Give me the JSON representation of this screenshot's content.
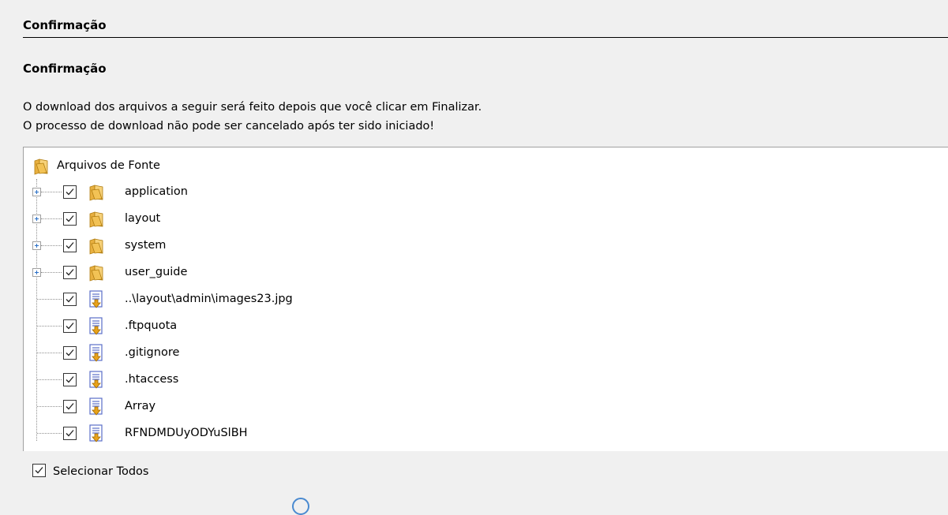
{
  "section_header": "Confirmação",
  "heading": "Confirmação",
  "description": {
    "line1": "O download dos arquivos a seguir será feito depois que você clicar em Finalizar.",
    "line2": "O processo de download não pode ser cancelado após ter sido iniciado!"
  },
  "tree": {
    "root_label": "Arquivos de Fonte",
    "folders": [
      {
        "label": "application",
        "checked": true,
        "icon": "folder-icon"
      },
      {
        "label": "layout",
        "checked": true,
        "icon": "folder-icon"
      },
      {
        "label": "system",
        "checked": true,
        "icon": "folder-icon"
      },
      {
        "label": "user_guide",
        "checked": true,
        "icon": "folder-icon"
      }
    ],
    "files": [
      {
        "label": "..\\layout\\admin\\images23.jpg",
        "checked": true,
        "icon": "file-download-icon"
      },
      {
        "label": ".ftpquota",
        "checked": true,
        "icon": "file-download-icon"
      },
      {
        "label": ".gitignore",
        "checked": true,
        "icon": "file-download-icon"
      },
      {
        "label": ".htaccess",
        "checked": true,
        "icon": "file-download-icon"
      },
      {
        "label": "Array",
        "checked": true,
        "icon": "file-download-icon"
      },
      {
        "label": "RFNDMDUyODYuSlBH",
        "checked": true,
        "icon": "file-download-icon"
      }
    ]
  },
  "footer": {
    "select_all_label": "Selecionar Todos",
    "select_all_checked": true
  },
  "colors": {
    "background": "#f0f0f0",
    "folder": "#f2c255",
    "file_icon": "#5b6fc8",
    "download_arrow": "#e8a21a"
  }
}
